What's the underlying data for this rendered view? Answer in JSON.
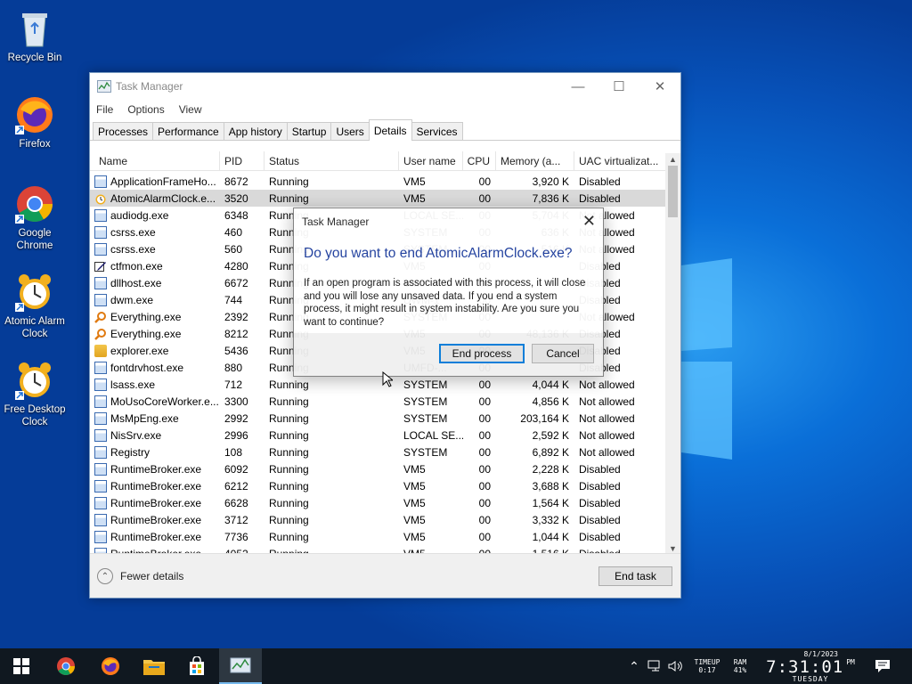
{
  "desktop": {
    "icons": [
      {
        "label_1": "Recycle Bin",
        "label_2": ""
      },
      {
        "label_1": "Firefox",
        "label_2": ""
      },
      {
        "label_1": "Google",
        "label_2": "Chrome"
      },
      {
        "label_1": "Atomic Alarm",
        "label_2": "Clock"
      },
      {
        "label_1": "Free Desktop",
        "label_2": "Clock"
      }
    ]
  },
  "window": {
    "title": "Task Manager",
    "menu": [
      "File",
      "Options",
      "View"
    ],
    "tabs": [
      "Processes",
      "Performance",
      "App history",
      "Startup",
      "Users",
      "Details",
      "Services"
    ],
    "active_tab": "Details",
    "columns": [
      "Name",
      "PID",
      "Status",
      "User name",
      "CPU",
      "Memory (a...",
      "UAC virtualizat..."
    ],
    "rows": [
      {
        "name": "ApplicationFrameHo...",
        "pid": "8672",
        "status": "Running",
        "user": "VM5",
        "cpu": "00",
        "mem": "3,920 K",
        "uac": "Disabled",
        "icon": "app-frame-icon"
      },
      {
        "name": "AtomicAlarmClock.e...",
        "pid": "3520",
        "status": "Running",
        "user": "VM5",
        "cpu": "00",
        "mem": "7,836 K",
        "uac": "Disabled",
        "icon": "alarm-clock-icon",
        "selected": true
      },
      {
        "name": "audiodg.exe",
        "pid": "6348",
        "status": "Running",
        "user": "LOCAL SE...",
        "cpu": "00",
        "mem": "5,704 K",
        "uac": "Not allowed",
        "icon": "process-icon"
      },
      {
        "name": "csrss.exe",
        "pid": "460",
        "status": "Running",
        "user": "SYSTEM",
        "cpu": "00",
        "mem": "636 K",
        "uac": "Not allowed",
        "icon": "process-icon"
      },
      {
        "name": "csrss.exe",
        "pid": "560",
        "status": "Running",
        "user": "SYSTEM",
        "cpu": "00",
        "mem": "516 K",
        "uac": "Not allowed",
        "icon": "process-icon"
      },
      {
        "name": "ctfmon.exe",
        "pid": "4280",
        "status": "Running",
        "user": "VM5",
        "cpu": "00",
        "mem": "",
        "uac": "Disabled",
        "icon": "pen-icon"
      },
      {
        "name": "dllhost.exe",
        "pid": "6672",
        "status": "Running",
        "user": "VM5",
        "cpu": "00",
        "mem": "",
        "uac": "Disabled",
        "icon": "process-icon"
      },
      {
        "name": "dwm.exe",
        "pid": "744",
        "status": "Running",
        "user": "DWM-1",
        "cpu": "00",
        "mem": "",
        "uac": "Disabled",
        "icon": "process-icon"
      },
      {
        "name": "Everything.exe",
        "pid": "2392",
        "status": "Running",
        "user": "SYSTEM",
        "cpu": "00",
        "mem": "",
        "uac": "Not allowed",
        "icon": "search-magnifier-icon"
      },
      {
        "name": "Everything.exe",
        "pid": "8212",
        "status": "Running",
        "user": "VM5",
        "cpu": "00",
        "mem": "48,136 K",
        "uac": "Disabled",
        "icon": "search-magnifier-icon"
      },
      {
        "name": "explorer.exe",
        "pid": "5436",
        "status": "Running",
        "user": "VM5",
        "cpu": "00",
        "mem": "",
        "uac": "Disabled",
        "icon": "folder-icon"
      },
      {
        "name": "fontdrvhost.exe",
        "pid": "880",
        "status": "Running",
        "user": "UMFD-...",
        "cpu": "00",
        "mem": "",
        "uac": "Disabled",
        "icon": "process-icon"
      },
      {
        "name": "lsass.exe",
        "pid": "712",
        "status": "Running",
        "user": "SYSTEM",
        "cpu": "00",
        "mem": "4,044 K",
        "uac": "Not allowed",
        "icon": "process-icon"
      },
      {
        "name": "MoUsoCoreWorker.e...",
        "pid": "3300",
        "status": "Running",
        "user": "SYSTEM",
        "cpu": "00",
        "mem": "4,856 K",
        "uac": "Not allowed",
        "icon": "process-icon"
      },
      {
        "name": "MsMpEng.exe",
        "pid": "2992",
        "status": "Running",
        "user": "SYSTEM",
        "cpu": "00",
        "mem": "203,164 K",
        "uac": "Not allowed",
        "icon": "process-icon"
      },
      {
        "name": "NisSrv.exe",
        "pid": "2996",
        "status": "Running",
        "user": "LOCAL SE...",
        "cpu": "00",
        "mem": "2,592 K",
        "uac": "Not allowed",
        "icon": "process-icon"
      },
      {
        "name": "Registry",
        "pid": "108",
        "status": "Running",
        "user": "SYSTEM",
        "cpu": "00",
        "mem": "6,892 K",
        "uac": "Not allowed",
        "icon": "process-icon"
      },
      {
        "name": "RuntimeBroker.exe",
        "pid": "6092",
        "status": "Running",
        "user": "VM5",
        "cpu": "00",
        "mem": "2,228 K",
        "uac": "Disabled",
        "icon": "process-icon"
      },
      {
        "name": "RuntimeBroker.exe",
        "pid": "6212",
        "status": "Running",
        "user": "VM5",
        "cpu": "00",
        "mem": "3,688 K",
        "uac": "Disabled",
        "icon": "process-icon"
      },
      {
        "name": "RuntimeBroker.exe",
        "pid": "6628",
        "status": "Running",
        "user": "VM5",
        "cpu": "00",
        "mem": "1,564 K",
        "uac": "Disabled",
        "icon": "process-icon"
      },
      {
        "name": "RuntimeBroker.exe",
        "pid": "3712",
        "status": "Running",
        "user": "VM5",
        "cpu": "00",
        "mem": "3,332 K",
        "uac": "Disabled",
        "icon": "process-icon"
      },
      {
        "name": "RuntimeBroker.exe",
        "pid": "7736",
        "status": "Running",
        "user": "VM5",
        "cpu": "00",
        "mem": "1,044 K",
        "uac": "Disabled",
        "icon": "process-icon"
      },
      {
        "name": "RuntimeBroker.exe",
        "pid": "4052",
        "status": "Running",
        "user": "VM5",
        "cpu": "00",
        "mem": "1,516 K",
        "uac": "Disabled",
        "icon": "process-icon"
      }
    ],
    "fewer_details": "Fewer details",
    "end_task": "End task"
  },
  "dialog": {
    "title": "Task Manager",
    "question": "Do you want to end AtomicAlarmClock.exe?",
    "body": "If an open program is associated with this process, it will close and you will lose any unsaved data. If you end a system process, it might result in system instability. Are you sure you want to continue?",
    "primary_button": "End process",
    "cancel_button": "Cancel"
  },
  "taskbar": {
    "apps": [
      "start-icon",
      "chrome-icon",
      "firefox-icon",
      "file-explorer-icon",
      "store-icon",
      "task-manager-icon"
    ],
    "tray": {
      "timeup_label": "TIMEUP",
      "timeup_value": "0:17",
      "ram_label": "RAM",
      "ram_value": "41%",
      "date": "8/1/2023",
      "time": "7:31:01",
      "ampm": "PM",
      "day": "TUESDAY"
    }
  },
  "colors": {
    "accent": "#0078d7",
    "dialog_heading": "#1a3a9b",
    "selected_row": "#d9d9d9"
  }
}
